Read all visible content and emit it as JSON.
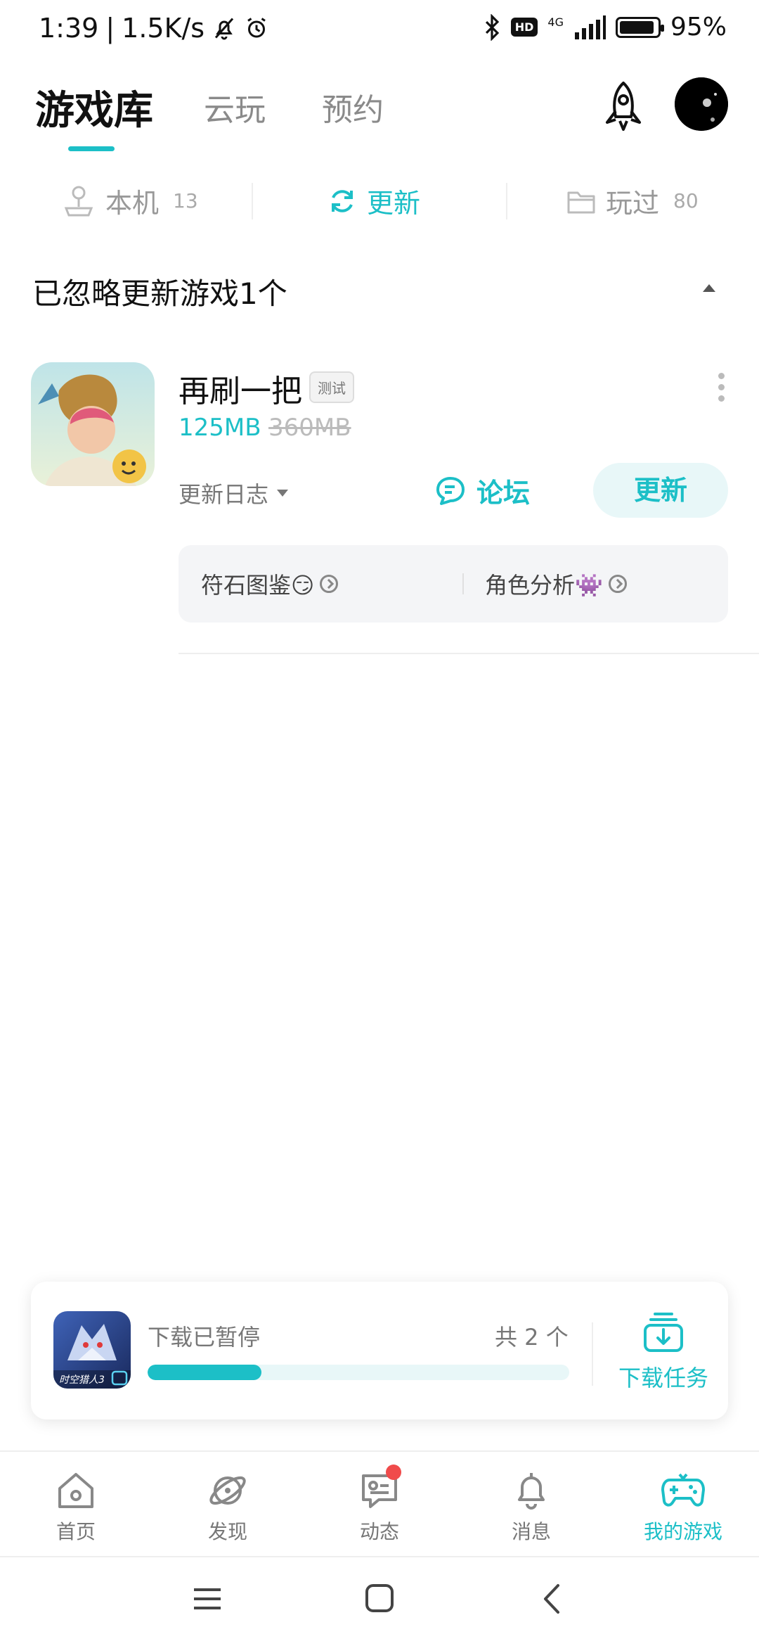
{
  "status_bar": {
    "time": "1:39",
    "speed": "1.5K/s",
    "hd": "HD",
    "network": "4G",
    "battery": "95%",
    "icons": [
      "bell-off-icon",
      "alarm-icon",
      "bluetooth-icon",
      "signal-icon",
      "battery-icon"
    ]
  },
  "header": {
    "tabs": [
      {
        "label": "游戏库",
        "active": true
      },
      {
        "label": "云玩",
        "active": false
      },
      {
        "label": "预约",
        "active": false
      }
    ],
    "accent": "#1cbfc7"
  },
  "subtabs": [
    {
      "label": "本机",
      "count": "13",
      "icon": "joystick-icon",
      "active": false
    },
    {
      "label": "更新",
      "count": "",
      "icon": "refresh-icon",
      "active": true
    },
    {
      "label": "玩过",
      "count": "80",
      "icon": "folder-icon",
      "active": false
    }
  ],
  "section": {
    "title": "已忽略更新游戏1个"
  },
  "game": {
    "name": "再刷一把",
    "badge": "测试",
    "size_new": "125MB",
    "size_old": "360MB",
    "changelog": "更新日志",
    "forum": "论坛",
    "update": "更新",
    "links": [
      {
        "label": "符石图鉴😏"
      },
      {
        "label": "角色分析👾"
      }
    ]
  },
  "download": {
    "status": "下载已暂停",
    "count": "共 2 个",
    "progress": 0.27,
    "task_label": "下载任务",
    "game_logo_text": "时空猎人3"
  },
  "bottom_nav": [
    {
      "label": "首页",
      "icon": "home-icon",
      "active": false
    },
    {
      "label": "发现",
      "icon": "planet-icon",
      "active": false
    },
    {
      "label": "动态",
      "icon": "message-icon",
      "active": false,
      "dot": true
    },
    {
      "label": "消息",
      "icon": "bell-icon",
      "active": false
    },
    {
      "label": "我的游戏",
      "icon": "gamepad-icon",
      "active": true
    }
  ]
}
